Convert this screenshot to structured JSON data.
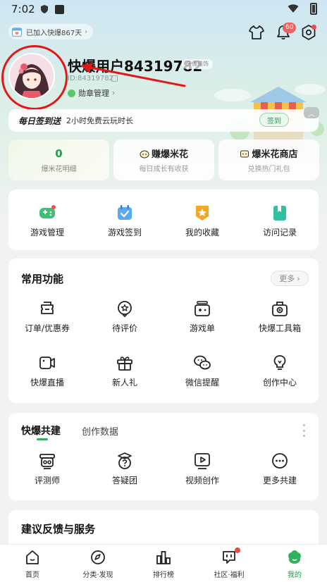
{
  "status_bar": {
    "time": "7:02"
  },
  "header": {
    "join_text": "已加入快爆867天",
    "bell_badge": "60"
  },
  "profile": {
    "username": "快爆用户84319782",
    "avatar_tag": "头像挂饰",
    "user_id": "ID:84319782",
    "medal_label": "勋章管理"
  },
  "signin": {
    "title": "每日签到送",
    "desc": "2小时免费云玩时长",
    "button": "签到"
  },
  "popcorn_cards": [
    {
      "value": "0",
      "label": "爆米花明细"
    },
    {
      "title": "赚爆米花",
      "sub": "每日成长有收获"
    },
    {
      "title": "爆米花商店",
      "sub": "兑换热门礼包"
    }
  ],
  "quick_actions": [
    {
      "label": "游戏管理",
      "icon": "gamepad-icon"
    },
    {
      "label": "游戏签到",
      "icon": "calendar-check-icon"
    },
    {
      "label": "我的收藏",
      "icon": "star-badge-icon"
    },
    {
      "label": "访问记录",
      "icon": "bookmark-book-icon"
    }
  ],
  "common": {
    "title": "常用功能",
    "more": "更多",
    "items": [
      {
        "label": "订单/优惠券",
        "icon": "coupon-icon"
      },
      {
        "label": "待评价",
        "icon": "star-bubble-icon"
      },
      {
        "label": "游戏单",
        "icon": "game-list-icon"
      },
      {
        "label": "快爆工具箱",
        "icon": "toolbox-icon"
      },
      {
        "label": "快爆直播",
        "icon": "video-camera-icon"
      },
      {
        "label": "新人礼",
        "icon": "gift-icon"
      },
      {
        "label": "微信提醒",
        "icon": "wechat-icon"
      },
      {
        "label": "创作中心",
        "icon": "lightbulb-icon"
      }
    ]
  },
  "build": {
    "tab_active": "快爆共建",
    "tab_inactive": "创作数据",
    "items": [
      {
        "label": "评测师",
        "icon": "reviewer-icon"
      },
      {
        "label": "答疑团",
        "icon": "question-bubble-icon"
      },
      {
        "label": "视频创作",
        "icon": "play-video-icon"
      },
      {
        "label": "更多共建",
        "icon": "more-dots-icon"
      }
    ]
  },
  "feedback": {
    "title": "建议反馈与服务"
  },
  "bottom_nav": [
    {
      "label": "首页"
    },
    {
      "label": "分类·发现"
    },
    {
      "label": "排行榜"
    },
    {
      "label": "社区·福利"
    },
    {
      "label": "我的"
    }
  ],
  "colors": {
    "accent": "#1aa34a",
    "badge": "#f06060",
    "annotation": "#e21818"
  }
}
